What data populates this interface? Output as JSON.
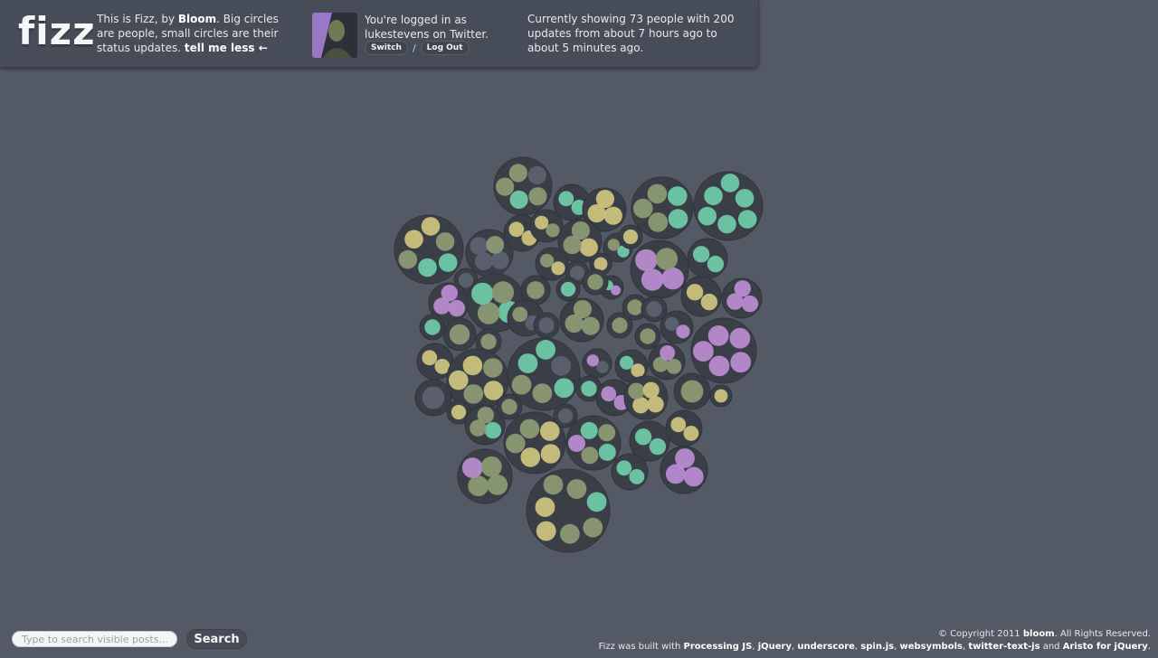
{
  "header": {
    "logo": "fizz",
    "about_prefix": "This is Fizz, by ",
    "about_brand": "Bloom",
    "about_suffix": ". Big circles are people, small circles are their status updates.",
    "tell_me_less": "tell me less ←",
    "login_text": "You're logged in as lukestevens on Twitter.",
    "switch_label": "Switch",
    "separator": "/",
    "logout_label": "Log Out",
    "status_text": "Currently showing 73 people with 200 updates from about 7 hours ago to about 5 minutes ago."
  },
  "search": {
    "placeholder": "Type to search visible posts...",
    "button_label": "Search"
  },
  "footer": {
    "copyright_prefix": "© Copyright 2011 ",
    "copyright_brand": "bloom",
    "copyright_suffix": ". All Rights Reserved.",
    "built_prefix": "Fizz was built with ",
    "libs": [
      "Processing JS",
      "jQuery",
      "underscore",
      "spin.js",
      "websymbols",
      "twitter-text-js"
    ],
    "built_and": " and ",
    "last_lib": "Aristo for jQuery",
    "built_end": "."
  },
  "colors": {
    "background": "#535a66",
    "person_circle": "#3a3f47",
    "teal": "#6cc9a7",
    "yellow": "#ccc27c",
    "sage": "#8a9a72",
    "purple": "#b88ad0",
    "gray": "#5b6170"
  }
}
